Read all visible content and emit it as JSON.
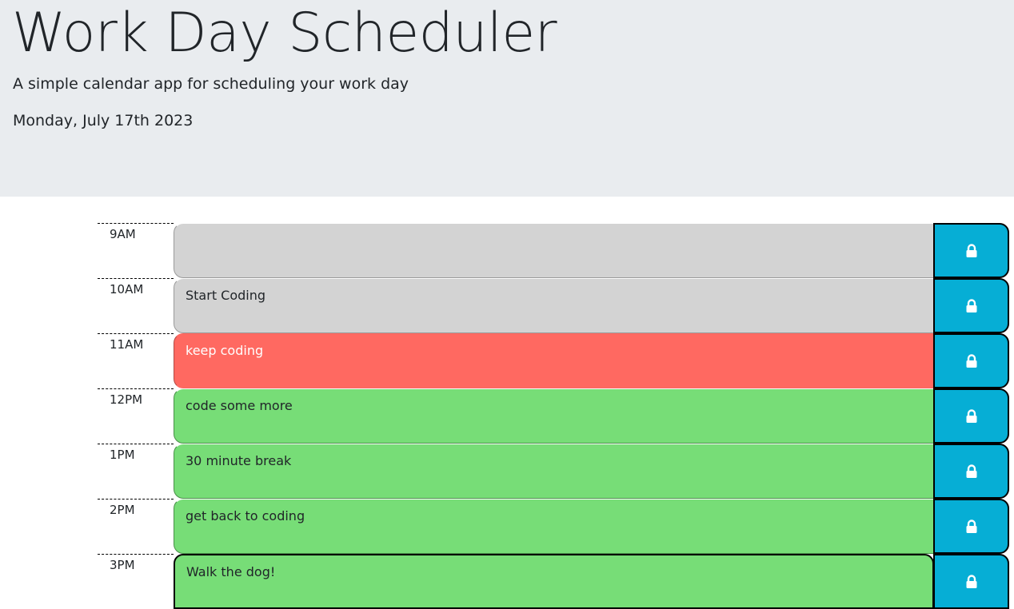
{
  "header": {
    "title": "Work Day Scheduler",
    "subtitle": "A simple calendar app for scheduling your work day",
    "current_day": "Monday, July 17th 2023"
  },
  "colors": {
    "past": "#d3d3d3",
    "present": "#ff6961",
    "future": "#77dd77",
    "save_button": "#06aed5",
    "header_background": "#e9ecef"
  },
  "blocks": [
    {
      "hour": "9AM",
      "text": "",
      "state": "past",
      "save_icon": "lock-icon"
    },
    {
      "hour": "10AM",
      "text": "Start Coding",
      "state": "past",
      "save_icon": "lock-icon"
    },
    {
      "hour": "11AM",
      "text": "keep coding",
      "state": "present",
      "save_icon": "lock-icon"
    },
    {
      "hour": "12PM",
      "text": "code some more",
      "state": "future",
      "save_icon": "lock-icon"
    },
    {
      "hour": "1PM",
      "text": "30 minute break",
      "state": "future",
      "save_icon": "lock-icon"
    },
    {
      "hour": "2PM",
      "text": "get back to coding",
      "state": "future",
      "save_icon": "lock-icon"
    },
    {
      "hour": "3PM",
      "text": "Walk the dog!",
      "state": "future",
      "save_icon": "lock-icon"
    }
  ]
}
